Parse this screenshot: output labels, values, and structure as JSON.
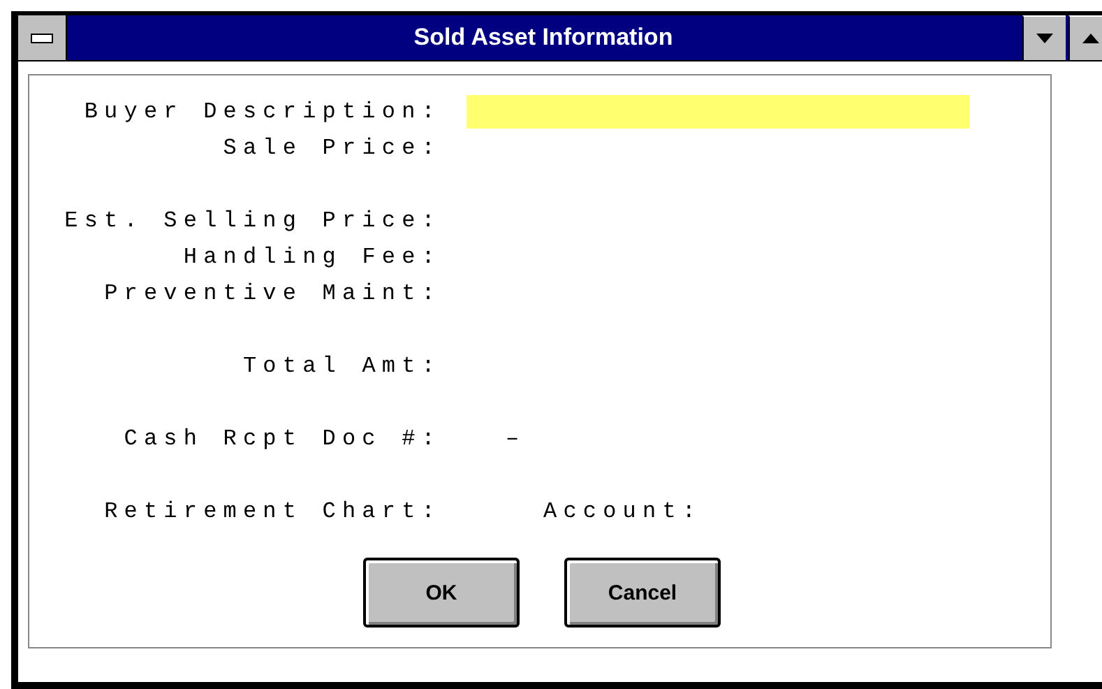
{
  "window": {
    "title": "Sold Asset Information"
  },
  "groups": [
    {
      "rows": [
        {
          "label": "Buyer Description:",
          "kind": "input"
        },
        {
          "label": "Sale Price:"
        }
      ]
    },
    {
      "rows": [
        {
          "label": "Est. Selling Price:"
        },
        {
          "label": "Handling Fee:"
        },
        {
          "label": "Preventive Maint:"
        }
      ]
    },
    {
      "rows": [
        {
          "label": "Total Amt:"
        }
      ]
    },
    {
      "rows": [
        {
          "label": "Cash Rcpt Doc #:",
          "kind": "value",
          "value": "–"
        }
      ]
    },
    {
      "rows": [
        {
          "label": "Retirement Chart:",
          "kind": "label",
          "value": "Account:"
        }
      ]
    }
  ],
  "buttons": [
    "OK",
    "Cancel"
  ]
}
